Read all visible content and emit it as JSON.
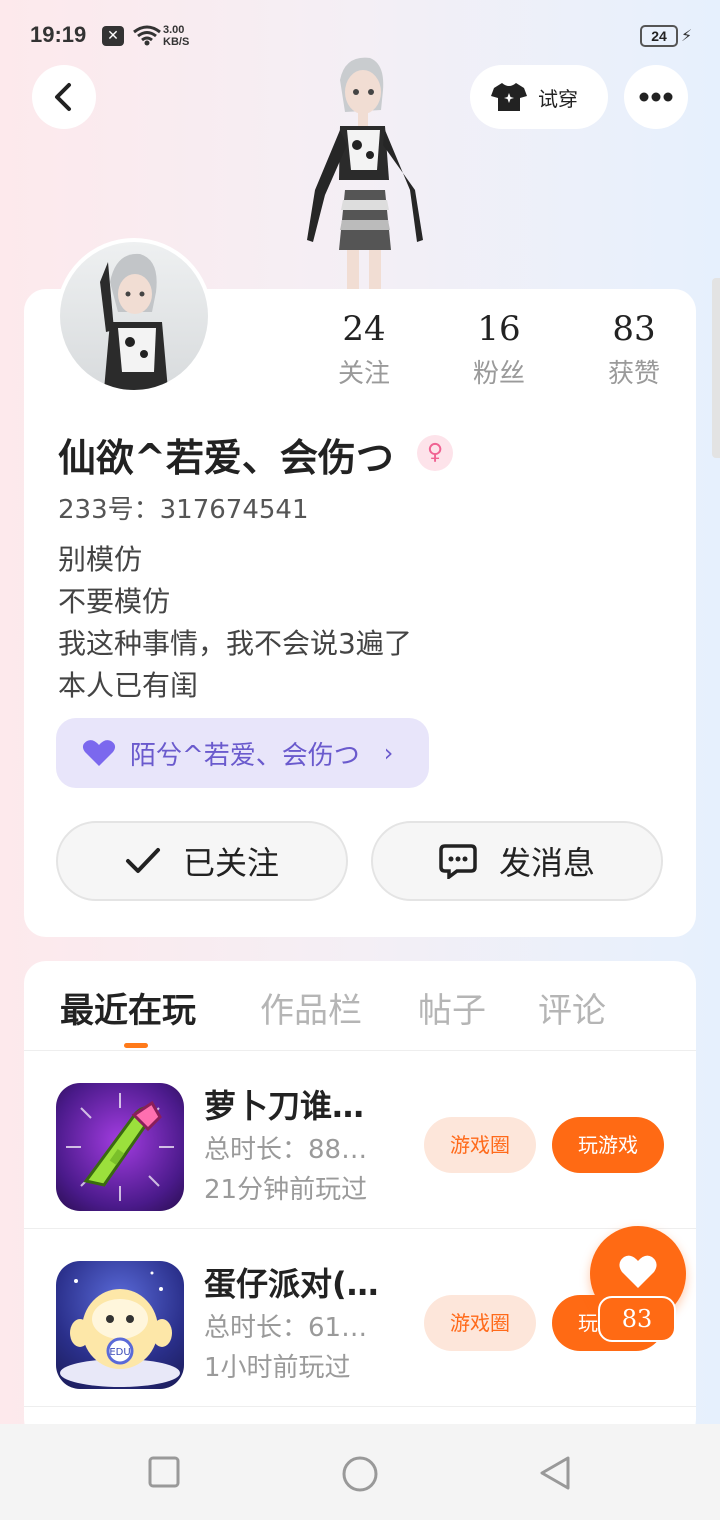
{
  "status_bar": {
    "time": "19:19",
    "notification_icon": "x-icon",
    "speed_value": "3.00",
    "speed_unit": "KB/S",
    "battery": "24"
  },
  "header": {
    "try_on_label": "试穿"
  },
  "profile": {
    "stats": [
      {
        "value": "24",
        "label": "关注"
      },
      {
        "value": "16",
        "label": "粉丝"
      },
      {
        "value": "83",
        "label": "获赞"
      }
    ],
    "nickname": "仙欲^若爱、会伤つ",
    "gender_icon": "♀",
    "uid": "233号：317674541",
    "bio": [
      "别模仿",
      "不要模仿",
      "我这种事情，我不会说3遍了",
      "本人已有闺"
    ],
    "cp_name": "陌兮^若爱、会伤つ",
    "follow_label": "已关注",
    "message_label": "发消息"
  },
  "tabs": [
    "最近在玩",
    "作品栏",
    "帖子",
    "评论"
  ],
  "games": [
    {
      "name": "萝卜刀谁…",
      "total_time": "总时长：88…",
      "last_played": "21分钟前玩过",
      "circle_label": "游戏圈",
      "play_label": "玩游戏"
    },
    {
      "name": "蛋仔派对(…",
      "total_time": "总时长：61…",
      "last_played": "1小时前玩过",
      "circle_label": "游戏圈",
      "play_label": "玩游戏"
    }
  ],
  "like": {
    "count": "83"
  },
  "colors": {
    "accent": "#ff6a14",
    "cp_chip": "#e8e5fa",
    "cp_text": "#6a5acd"
  }
}
